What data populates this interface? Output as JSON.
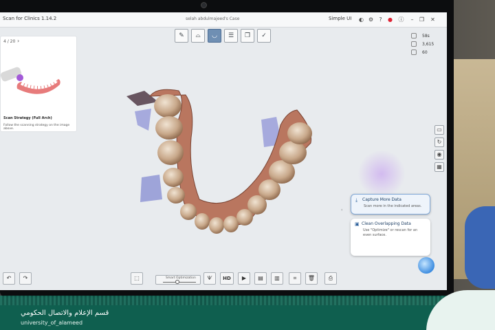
{
  "app": {
    "title": "Scan for Clinics 1.14.2",
    "document_title": "selah abdulmajeed's Case",
    "brand": "Simple UI"
  },
  "strategy_card": {
    "pager": "4 / 20",
    "title": "Scan Strategy (Full Arch)",
    "description": "Follow the scanning strategy on the image above."
  },
  "mode_toolbar": {
    "items": [
      {
        "icon": "clipboard-edit-icon"
      },
      {
        "icon": "upper-jaw-icon"
      },
      {
        "icon": "lower-jaw-icon",
        "active": true
      },
      {
        "icon": "bite-icon"
      },
      {
        "icon": "copy-icon"
      },
      {
        "icon": "checklist-icon"
      }
    ]
  },
  "stats": {
    "items": [
      {
        "icon": "timer-icon",
        "value": "58s"
      },
      {
        "icon": "images-icon",
        "value": "3,615"
      },
      {
        "icon": "fps-icon",
        "value": "60"
      }
    ]
  },
  "right_tools": [
    {
      "icon": "camera-icon"
    },
    {
      "icon": "rotate-icon"
    },
    {
      "icon": "color-icon"
    },
    {
      "icon": "layers-icon"
    }
  ],
  "tips": [
    {
      "title": "Capture More Data",
      "description": "Scan more in the indicated areas."
    },
    {
      "title": "Clean Overlapping Data",
      "description": "Use \"Optimize\" or rescan for an even surface."
    }
  ],
  "bottom_toolbar": {
    "slider_label": "Smart Optimization",
    "hd_label": "HD"
  },
  "footer": {
    "arabic_name": "قسم الإعلام والاتصال الحكومي",
    "english_name": "university_of_alameed"
  },
  "colors": {
    "accent": "#6f8fb3",
    "footer_green": "#0f5f4f",
    "tip_border": "#7fa7d6"
  }
}
